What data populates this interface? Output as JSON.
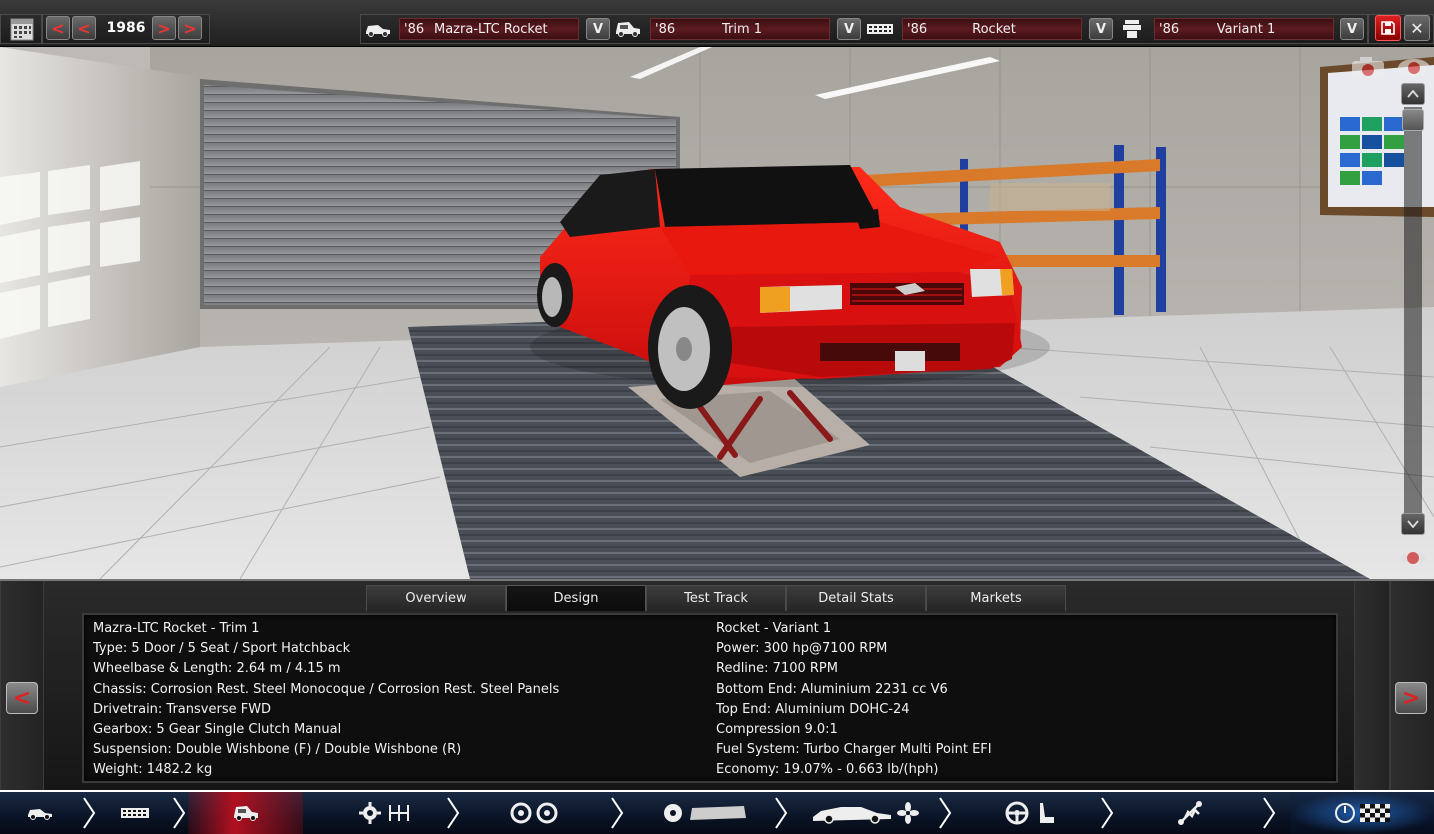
{
  "topbar": {
    "year": "1986",
    "selectors": [
      {
        "prefix": "'86",
        "value": "Mazra-LTC Rocket",
        "icon": "car-model-icon"
      },
      {
        "prefix": "'86",
        "value": "Trim 1",
        "icon": "car-trim-icon"
      },
      {
        "prefix": "'86",
        "value": "Rocket",
        "icon": "engine-icon"
      },
      {
        "prefix": "'86",
        "value": "Variant 1",
        "icon": "engine-variant-icon"
      }
    ],
    "dropdown_glyph": "V",
    "prev_glyph": "<",
    "next_glyph": ">",
    "close_glyph": "✕"
  },
  "tabs": [
    {
      "label": "Overview",
      "active": false
    },
    {
      "label": "Design",
      "active": true
    },
    {
      "label": "Test Track",
      "active": false
    },
    {
      "label": "Detail Stats",
      "active": false
    },
    {
      "label": "Markets",
      "active": false
    }
  ],
  "stats": {
    "left": [
      "Mazra-LTC Rocket - Trim 1",
      "Type: 5 Door / 5 Seat / Sport Hatchback",
      "Wheelbase & Length: 2.64 m / 4.15 m",
      "Chassis: Corrosion Rest. Steel Monocoque / Corrosion Rest. Steel Panels",
      "Drivetrain: Transverse FWD",
      "Gearbox: 5 Gear Single Clutch Manual",
      "Suspension: Double Wishbone (F) / Double Wishbone (R)",
      "Weight: 1482.2 kg"
    ],
    "right": [
      "Rocket - Variant 1",
      "Power: 300 hp@7100 RPM",
      "Redline: 7100 RPM",
      "Bottom End: Aluminium 2231 cc V6",
      "Top End: Aluminium DOHC-24",
      "Compression 9.0:1",
      "Fuel System: Turbo Charger Multi Point EFI",
      "Economy: 19.07% - 0.663 lb/(hph)"
    ]
  },
  "nav": {
    "prev": "<",
    "next": ">"
  },
  "colors": {
    "accent_red": "#d22020",
    "car_red": "#e01010",
    "nav_blue": "#0a1426"
  }
}
